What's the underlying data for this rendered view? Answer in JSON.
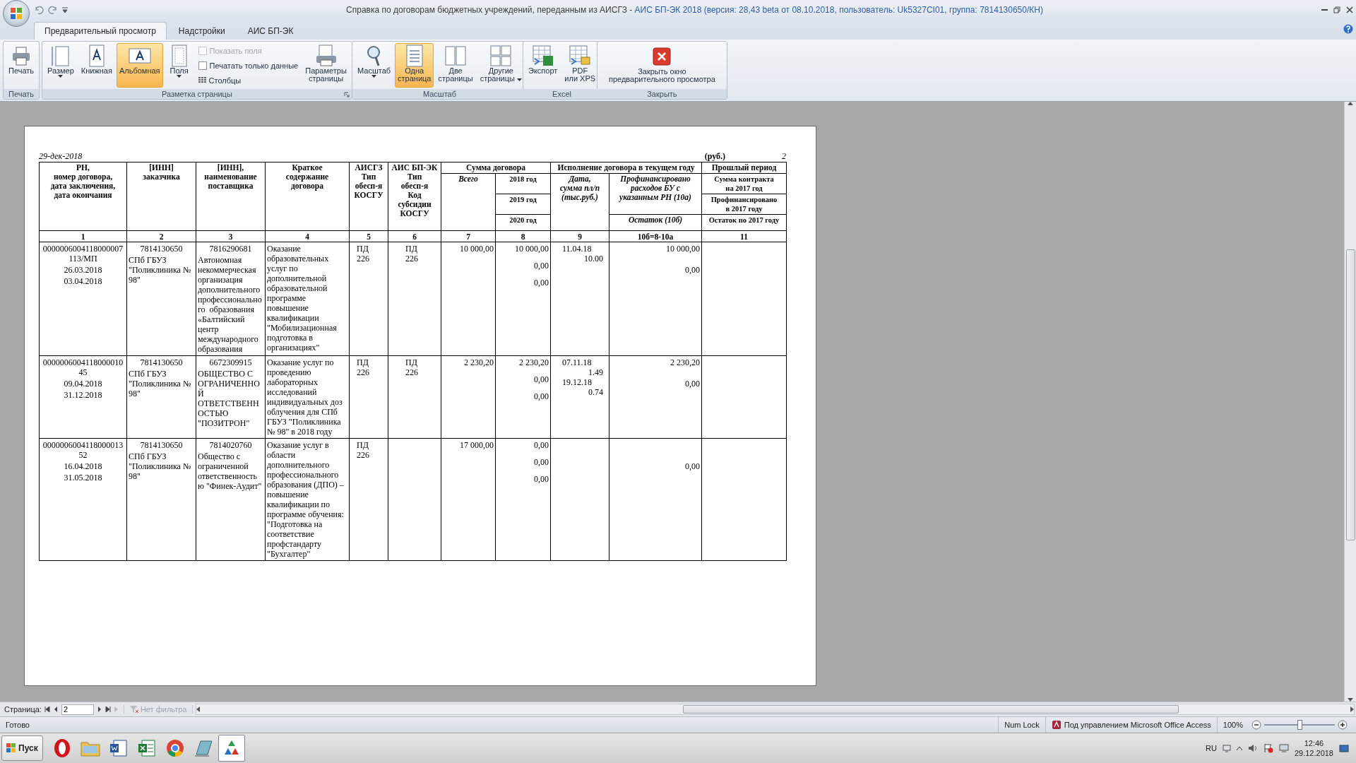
{
  "window": {
    "title": "Справка по договорам бюджетных учреждений, переданным из АИСГЗ -",
    "title_info": "АИС БП-ЭК 2018 (версия: 28,43 beta от 08.10.2018, пользователь: Uk5327CI01, группа: 7814130650/КН)"
  },
  "tabs": [
    {
      "label": "Предварительный просмотр",
      "selected": true
    },
    {
      "label": "Надстройки",
      "selected": false
    },
    {
      "label": "АИС БП-ЭК",
      "selected": false
    }
  ],
  "ribbon": {
    "groups": [
      {
        "label": "Печать",
        "launcher": false,
        "items": [
          {
            "kind": "large",
            "label": "Печать",
            "selected": false,
            "dropdown": false
          }
        ]
      },
      {
        "label": "Разметка страницы",
        "launcher": true,
        "items": [
          {
            "kind": "large",
            "label": "Размер",
            "selected": false,
            "dropdown": true
          },
          {
            "kind": "large",
            "label": "Книжная",
            "selected": false,
            "dropdown": false
          },
          {
            "kind": "large",
            "label": "Альбомная",
            "selected": true,
            "dropdown": false
          },
          {
            "kind": "large",
            "label": "Поля",
            "selected": false,
            "dropdown": true
          },
          {
            "kind": "checkbox",
            "label": "Показать поля",
            "checked": false,
            "disabled": true
          },
          {
            "kind": "checkbox",
            "label": "Печатать только данные",
            "checked": false,
            "disabled": false
          },
          {
            "kind": "small",
            "label": "Столбцы",
            "selected": false
          },
          {
            "kind": "large",
            "label": "Параметры\nстраницы",
            "selected": false,
            "dropdown": false
          }
        ]
      },
      {
        "label": "Масштаб",
        "launcher": false,
        "items": [
          {
            "kind": "large",
            "label": "Масштаб",
            "selected": false,
            "dropdown": true
          },
          {
            "kind": "large",
            "label": "Одна\nстраница",
            "selected": true,
            "dropdown": false
          },
          {
            "kind": "large",
            "label": "Две\nстраницы",
            "selected": false,
            "dropdown": false
          },
          {
            "kind": "large",
            "label": "Другие\nстраницы",
            "selected": false,
            "dropdown": true
          }
        ]
      },
      {
        "label": "Excel",
        "launcher": false,
        "items": [
          {
            "kind": "large",
            "label": "Экспорт",
            "selected": false,
            "dropdown": false
          },
          {
            "kind": "large",
            "label": "PDF\nили XPS",
            "selected": false,
            "dropdown": false
          }
        ]
      },
      {
        "label": "Закрыть",
        "launcher": false,
        "items": [
          {
            "kind": "large",
            "label": "Закрыть окно\nпредварительного просмотра",
            "selected": false,
            "dropdown": false
          }
        ]
      }
    ]
  },
  "report": {
    "date": "29-дек-2018",
    "units": "(руб.)",
    "page_number": "2",
    "header": [
      {
        "text": "РН,\nномер договора,\nдата заключения,\nдата окончания",
        "italic": false
      },
      {
        "text": "[ИНН]\nзаказчика",
        "italic": false
      },
      {
        "text": "[ИНН],\nнаименование\nпоставщика",
        "italic": false
      },
      {
        "text": "Краткое\nсодержание\nдоговора",
        "italic": false
      },
      {
        "text": "АИСГЗ\nТип\nобесп-я\nКОСГУ",
        "italic": false
      },
      {
        "text": "АИС БП-ЭК\nТип\nобесп-я\nКод\nсубсидии\nКОСГУ",
        "italic": false
      },
      {
        "text": "Сумма договора",
        "italic": false
      },
      {
        "text": "Исполнение договора в текущем году",
        "italic": false
      },
      {
        "text": "Прошлый период",
        "italic": false
      },
      {
        "text": "Всего",
        "italic": true
      },
      {
        "text": "2018 год",
        "italic": false
      },
      {
        "text": "Дата,\nсумма пл/п\n(тыс.руб.)",
        "italic": true
      },
      {
        "text": "Профинансировано\nрасходов БУ с\nуказанным РН (10а)",
        "italic": true
      },
      {
        "text": "Сумма контракта\nна 2017 год",
        "italic": false
      },
      {
        "text": "2019 год",
        "italic": false
      },
      {
        "text": "Профинансировано\nв 2017 году",
        "italic": false
      },
      {
        "text": "2020 год",
        "italic": false
      },
      {
        "text": "Остаток (10б)",
        "italic": true
      },
      {
        "text": "Остаток по 2017 году",
        "italic": false
      }
    ],
    "column_numbers": [
      "1",
      "2",
      "3",
      "4",
      "5",
      "6",
      "7",
      "8",
      "9",
      "10б=8-10а",
      "11"
    ],
    "rows": [
      {
        "contract_number": "0000006004118000007113/МП",
        "contract_date": "26.03.2018",
        "end_date": "03.04.2018",
        "customer_inn": "7814130650",
        "customer_name": "СПб ГБУЗ \"Поликлиника № 98\"",
        "supplier_inn": "7816290681",
        "supplier_name": "Автономная некоммерческая организация дополнительногопрофессионального  образования «Балтийский центр международного образования",
        "description": "Оказание образовательных услуг по дополнительной образовательной программе повышение квалификации \"Мобилизационная подготовка в организациях\"",
        "aisgz": [
          "ПД",
          "226"
        ],
        "aisbp": [
          "ПД",
          "226"
        ],
        "total": "10 000,00",
        "amounts": [
          "10 000,00",
          "0,00",
          "0,00"
        ],
        "payments": [
          {
            "date": "11.04.18",
            "amount": "10.00"
          }
        ],
        "financed": "10 000,00",
        "remainder": "0,00"
      },
      {
        "contract_number": "000000600411800001045",
        "contract_date": "09.04.2018",
        "end_date": "31.12.2018",
        "customer_inn": "7814130650",
        "customer_name": "СПб ГБУЗ \"Поликлиника № 98\"",
        "supplier_inn": "6672309915",
        "supplier_name": "ОБЩЕСТВО С ОГРАНИЧЕННОЙ ОТВЕТСТВЕННОСТЬЮ \"ПОЗИТРОН\"",
        "description": "Оказание услуг по проведению лабораторных исследований индивидуальных доз облучения для СПб ГБУЗ \"Поликлиника № 98\" в 2018 году",
        "aisgz": [
          "ПД",
          "226"
        ],
        "aisbp": [
          "ПД",
          "226"
        ],
        "total": "2 230,20",
        "amounts": [
          "2 230,20",
          "0,00",
          "0,00"
        ],
        "payments": [
          {
            "date": "07.11.18",
            "amount": "1.49"
          },
          {
            "date": "19.12.18",
            "amount": "0.74"
          }
        ],
        "financed": "2 230,20",
        "remainder": "0,00"
      },
      {
        "contract_number": "000000600411800001352",
        "contract_date": "16.04.2018",
        "end_date": "31.05.2018",
        "customer_inn": "7814130650",
        "customer_name": "СПб ГБУЗ \"Поликлиника № 98\"",
        "supplier_inn": "7814020760",
        "supplier_name": "Общество с ограниченной ответственностью \"Финек-Аудит\"",
        "description": "Оказание услуг в области дополнительного профессионального образования (ДПО) – повышение квалификации по программе обучения: \"Подготовка на соответствие профстандарту \"Бухгалтер\"",
        "aisgz": [
          "ПД",
          "226"
        ],
        "total": "17 000,00",
        "amounts": [
          "0,00",
          "0,00",
          "0,00"
        ],
        "remainder": "0,00"
      }
    ]
  },
  "navigation": {
    "label": "Страница:",
    "page": "2",
    "filter": "Нет фильтра"
  },
  "status_bar": {
    "status": "Готово",
    "num_lock": "Num Lock",
    "managed_by": "Под управлением Microsoft Office Access",
    "zoom": "100%",
    "zoom_slider": {
      "level": 0.5
    }
  },
  "taskbar": {
    "start": "Пуск",
    "apps": [
      {
        "selected": false
      },
      {
        "selected": false
      },
      {
        "selected": false
      },
      {
        "selected": false
      },
      {
        "selected": false
      },
      {
        "selected": false
      },
      {
        "selected": true
      }
    ],
    "language": "RU",
    "time": "12:46",
    "date": "29.12.2018"
  }
}
